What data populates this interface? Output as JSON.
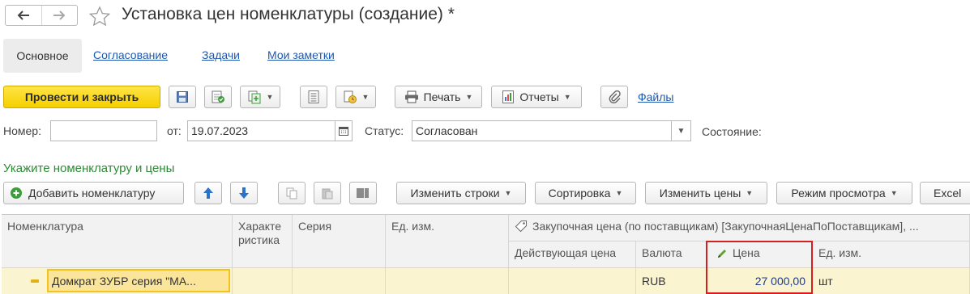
{
  "window": {
    "title": "Установка цен номенклатуры (создание) *"
  },
  "nav": {
    "back_icon": "arrow-left-icon",
    "forward_icon": "arrow-right-icon",
    "favorite_icon": "star-icon"
  },
  "tabs": [
    {
      "label": "Основное",
      "active": true
    },
    {
      "label": "Согласование"
    },
    {
      "label": "Задачи"
    },
    {
      "label": "Мои заметки"
    }
  ],
  "toolbar": {
    "post_close_label": "Провести и закрыть",
    "print_label": "Печать",
    "reports_label": "Отчеты",
    "files_label": "Файлы"
  },
  "fields": {
    "number_label": "Номер:",
    "number_value": "",
    "date_label": "от:",
    "date_value": "19.07.2023",
    "status_label": "Статус:",
    "status_value": "Согласован",
    "state_label": "Состояние:"
  },
  "section": {
    "title": "Укажите номенклатуру и цены"
  },
  "table_toolbar": {
    "add_label": "Добавить номенклатуру",
    "change_rows_label": "Изменить строки",
    "sort_label": "Сортировка",
    "change_prices_label": "Изменить цены",
    "view_mode_label": "Режим просмотра",
    "excel_label": "Excel"
  },
  "grid": {
    "headers": {
      "nomenclature": "Номенклатура",
      "characteristic": "Характеристика",
      "series": "Серия",
      "unit": "Ед. изм.",
      "price_group": "Закупочная цена (по поставщикам) [ЗакупочнаяЦенаПоПоставщикам], ...",
      "current_price": "Действующая цена",
      "currency": "Валюта",
      "price": "Цена",
      "price_unit": "Ед. изм."
    },
    "rows": [
      {
        "nomenclature": "Домкрат ЗУБР серия \"МА...",
        "characteristic": "",
        "series": "",
        "unit": "",
        "current_price": "",
        "currency": "RUB",
        "price": "27 000,00",
        "price_unit": "шт"
      }
    ]
  },
  "colors": {
    "primary_button": "#f5cf00",
    "link": "#1c58b2",
    "section_title": "#2d8a35",
    "row_highlight": "#fbf4d1",
    "price_frame": "#d62020"
  }
}
